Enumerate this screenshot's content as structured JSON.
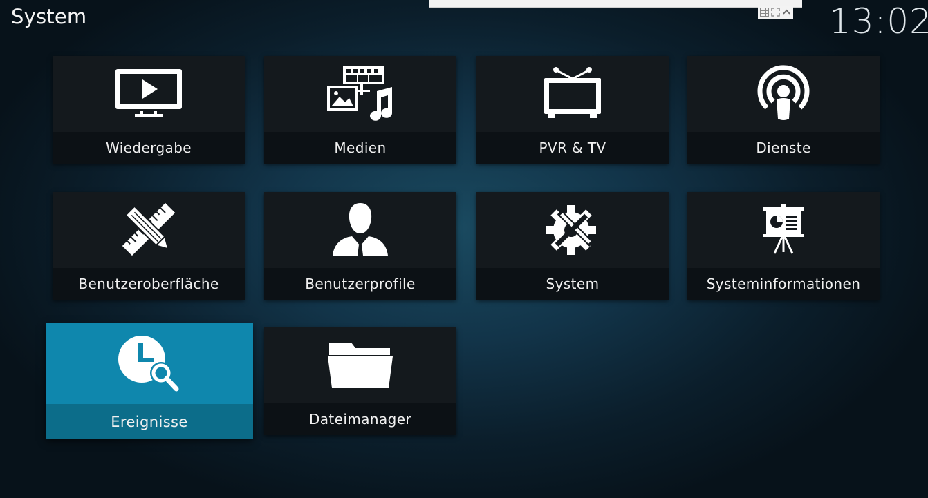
{
  "header": {
    "title": "System",
    "clock": "13:02"
  },
  "tiles": [
    {
      "label": "Wiedergabe",
      "icon": "tv-play-icon"
    },
    {
      "label": "Medien",
      "icon": "media-icon"
    },
    {
      "label": "PVR & TV",
      "icon": "tv-antenna-icon"
    },
    {
      "label": "Dienste",
      "icon": "broadcast-icon"
    },
    {
      "label": "Benutzeroberfläche",
      "icon": "pencil-ruler-icon"
    },
    {
      "label": "Benutzerprofile",
      "icon": "user-profile-icon"
    },
    {
      "label": "System",
      "icon": "gear-tools-icon"
    },
    {
      "label": "Systeminformationen",
      "icon": "presentation-icon"
    },
    {
      "label": "Ereignisse",
      "icon": "clock-search-icon",
      "focused": true
    },
    {
      "label": "Dateimanager",
      "icon": "folder-icon"
    }
  ],
  "colors": {
    "focus": "#0f87ad",
    "tile": "#14191d",
    "label_bar": "#0c1115"
  }
}
